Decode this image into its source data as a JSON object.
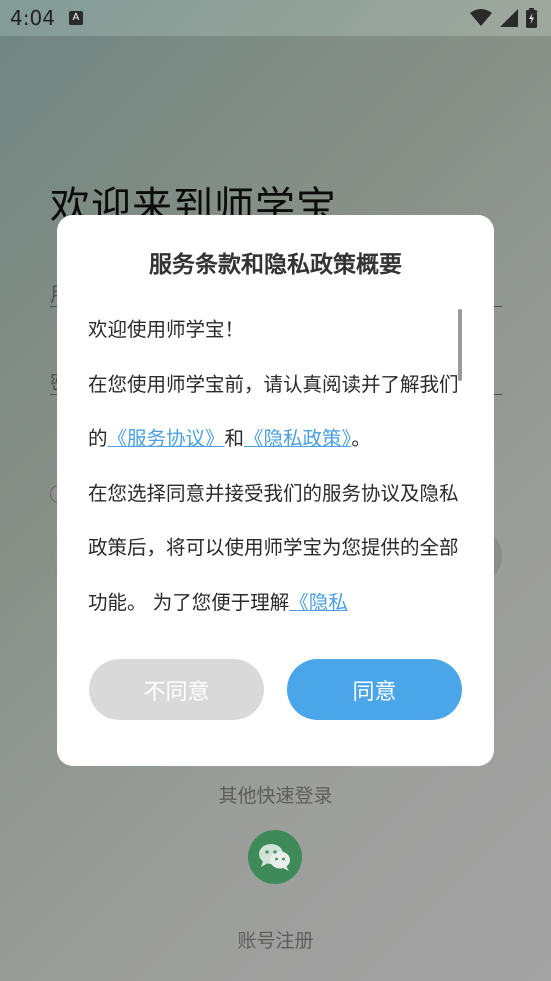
{
  "status_bar": {
    "time": "4:04",
    "notif_icon": "A"
  },
  "background": {
    "title": "欢迎来到师学宝",
    "input1_char": "用",
    "input2_char": "密",
    "other_login_label": "其他快速登录",
    "wechat_icon": "wechat-icon",
    "register_label": "账号注册"
  },
  "dialog": {
    "title": "服务条款和隐私政策概要",
    "greeting": "欢迎使用师学宝！",
    "para1": " 在您使用师学宝前，请认真阅读并了解我们的",
    "link_service": "《服务协议》",
    "and": "和",
    "link_privacy": "《隐私政策》",
    "period": "。",
    "para2": "在您选择同意并接受我们的服务协议及隐私政策后，将可以使用师学宝为您提供的全部功能。 为了您便于理解",
    "link_privacy_tail": "《隐私",
    "disagree_label": "不同意",
    "agree_label": "同意"
  },
  "colors": {
    "accent": "#4aa6e8",
    "link": "#4a9fe3",
    "wechat": "#3f8a59",
    "disabled_button": "#d9d9d9"
  }
}
